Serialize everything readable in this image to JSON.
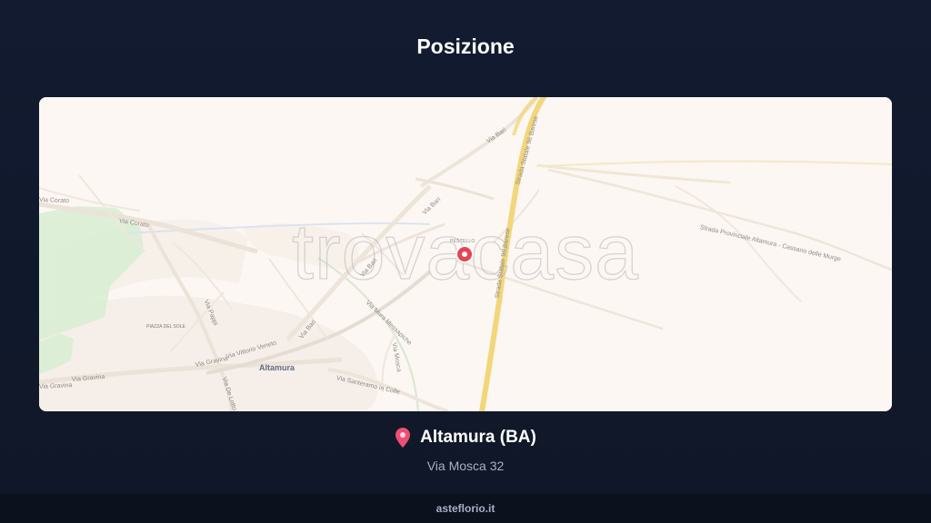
{
  "header": {
    "title": "Posizione"
  },
  "map": {
    "watermark": "trovacasa",
    "pin_label": "PESTELLO",
    "city_label": "Altamura",
    "place_label": "PIAZZA DEL SOLE",
    "roads": [
      {
        "name": "Via Bari"
      },
      {
        "name": "Via Bari"
      },
      {
        "name": "Via Bari"
      },
      {
        "name": "Via Bari"
      },
      {
        "name": "Via Corato"
      },
      {
        "name": "Via Corato"
      },
      {
        "name": "Via Gravina"
      },
      {
        "name": "Via Gravina"
      },
      {
        "name": "Via Gravina"
      },
      {
        "name": "Via Vittorio Veneto"
      },
      {
        "name": "Via Santeramo in Colle"
      },
      {
        "name": "Strada Statale 96 Barese"
      },
      {
        "name": "Strada Statale 96 Barese"
      },
      {
        "name": "Strada Provinciale Altamura - Cassano delle Murge"
      },
      {
        "name": "Via Mura Messapiche"
      },
      {
        "name": "Via Pappi"
      },
      {
        "name": "Via De Lotto"
      },
      {
        "name": "Via Mosca"
      }
    ],
    "colors": {
      "background": "#fcf7f2",
      "park": "#d7edd1",
      "highway": "#f2d67a",
      "marker": "#e84352"
    }
  },
  "location": {
    "city": "Altamura (BA)",
    "address": "Via Mosca 32",
    "icon": "map-pin-icon"
  },
  "footer": {
    "brand": "asteflorio.it"
  }
}
